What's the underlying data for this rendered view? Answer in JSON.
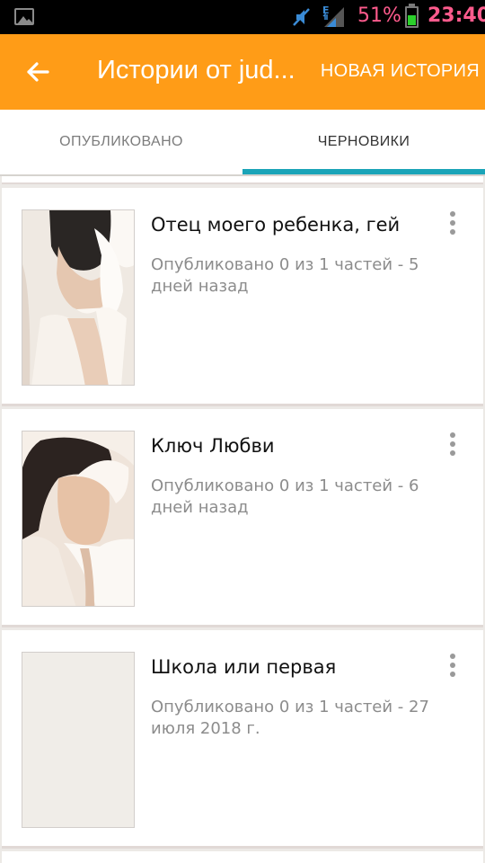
{
  "status_bar": {
    "battery_percent": "51%",
    "time": "23:40",
    "network_type": "E",
    "icons": [
      "gallery-icon",
      "mute-icon",
      "signal-icon",
      "battery-icon"
    ]
  },
  "app_bar": {
    "title": "Истории от jud...",
    "new_story_label": "НОВАЯ ИСТОРИЯ",
    "color": "#ff9c17",
    "icons": [
      "back-arrow-icon"
    ]
  },
  "tabs": [
    {
      "label": "ОПУБЛИКОВАНО",
      "selected": false
    },
    {
      "label": "ЧЕРНОВИКИ",
      "selected": true
    }
  ],
  "accent_color": "#1aa4b8",
  "stories": [
    {
      "title": "Отец моего ребенка, гей",
      "meta": "Опубликовано 0 из 1 частей - 5 дней назад",
      "cover": "photo"
    },
    {
      "title": "Ключ Любви",
      "meta": "Опубликовано 0 из 1 частей - 6 дней назад",
      "cover": "photo"
    },
    {
      "title": "Школа или первая",
      "meta": "Опубликовано 0 из 1 частей - 27 июля 2018 г.",
      "cover": "blank"
    }
  ]
}
